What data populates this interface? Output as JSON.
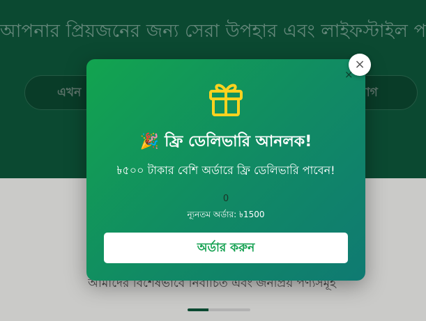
{
  "hero": {
    "heading": "আপনার প্রিয়জনের জন্য সেরা উপহার এবং লাইফস্টাইল পণ্য",
    "left_button": "এখন",
    "right_button": "যোগ"
  },
  "section": {
    "subtitle": "আমাদের বিশেষভাবে নির্বাচিত এবং জনপ্রিয় পণ্যসমূহ"
  },
  "modal": {
    "close_symbol": "×",
    "inner_close_symbol": "×",
    "gift_icon": "gift-icon",
    "party_icon": "🎉",
    "title": "ফ্রি ডেলিভারি আনলক!",
    "subtitle": "৳৫০০ টাকার বেশি অর্ডারে ফ্রি ডেলিভারি পাবেন!",
    "progress_value": "0",
    "min_order": "ন্যূনতম অর্ডার: ৳1500",
    "order_button": "অর্ডার করুন"
  },
  "colors": {
    "hero_bg": "#0e5a3c",
    "modal_gradient_start": "#12a44f",
    "modal_gradient_end": "#0f7a72",
    "gift_yellow": "#ffd21f",
    "button_text": "#12a04f"
  }
}
